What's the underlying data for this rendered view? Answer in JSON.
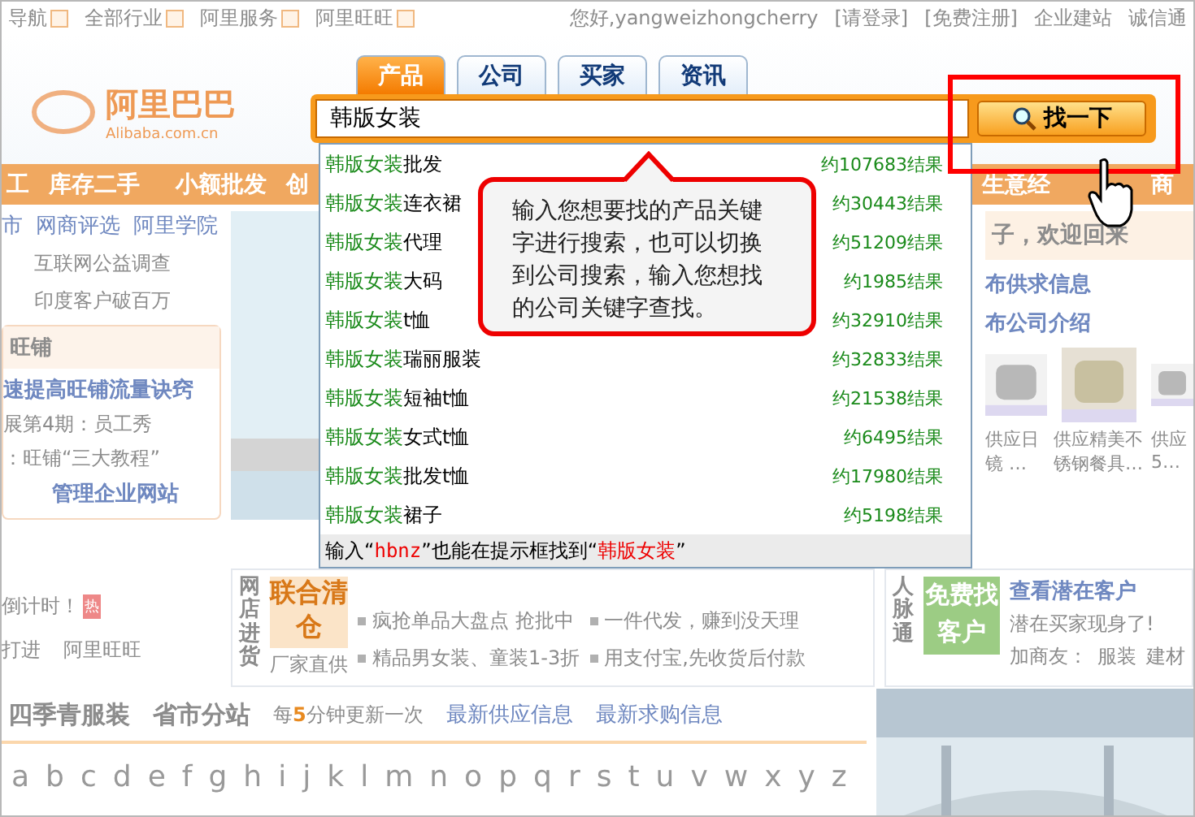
{
  "top_bar": {
    "menus": [
      "导航",
      "全部行业",
      "阿里服务",
      "阿里旺旺"
    ],
    "greeting": "您好,yangweizhongcherry",
    "login": "[请登录]",
    "register": "[免费注册]",
    "right_links": [
      "企业建站",
      "诚信通"
    ]
  },
  "logo": {
    "name": "阿里巴巴",
    "domain": "Alibaba.com.cn"
  },
  "nav": [
    "工",
    "库存二手",
    "小额批发",
    "创",
    "生意经",
    "商"
  ],
  "left": {
    "links": [
      "市",
      "网商评选",
      "阿里学院"
    ],
    "news": [
      "互联网公益调查",
      "印度客户破百万"
    ],
    "shop_title": "旺铺",
    "shop_headline": "速提高旺铺流量诀窍",
    "shop_items": [
      "展第4期：员工秀",
      "：旺铺“三大教程”"
    ],
    "manage": "管理企业网站",
    "countdown": "倒计时！",
    "hot": "热",
    "more": [
      "打进",
      "阿里旺旺"
    ]
  },
  "right": {
    "welcome": "子，欢迎回来",
    "actions": [
      "布供求信息",
      "布公司介绍"
    ],
    "products": [
      "供应日镜 …",
      "供应精美不锈钢餐具…",
      "供应5…"
    ]
  },
  "market": {
    "title": "网店进货",
    "promo": "联合清仓",
    "promo_caption": "厂家直供",
    "items": [
      "疯抢单品大盘点 抢批中",
      "精品男女装、童装1-3折"
    ],
    "items_2": [
      "一件代发，赚到没天理",
      "用支付宝,先收货后付款"
    ]
  },
  "contacts": {
    "title": "人脉通",
    "badge": "免费找客户",
    "link": "查看潜在客户",
    "text": "潜在买家现身了!",
    "tags": [
      "加商友：",
      "服装",
      "建材"
    ]
  },
  "categories": {
    "tabs": [
      "四季青服装",
      "省市分站"
    ],
    "update_before": "每",
    "update_num": "5",
    "update_after": "分钟更新一次",
    "links": [
      "最新供应信息",
      "最新求购信息"
    ]
  },
  "letters": [
    "a",
    "b",
    "c",
    "d",
    "e",
    "f",
    "g",
    "h",
    "i",
    "j",
    "k",
    "l",
    "m",
    "n",
    "o",
    "p",
    "q",
    "r",
    "s",
    "t",
    "u",
    "v",
    "w",
    "x",
    "y",
    "z"
  ],
  "search": {
    "tabs": [
      {
        "label": "产品",
        "selected": true
      },
      {
        "label": "公司",
        "selected": false
      },
      {
        "label": "买家",
        "selected": false
      },
      {
        "label": "资讯",
        "selected": false
      }
    ],
    "value": "韩版女装",
    "button": "找一下",
    "suggestions": [
      {
        "keyword": "韩版女装",
        "rest": "批发",
        "count": "约107683结果"
      },
      {
        "keyword": "韩版女装",
        "rest": "连衣裙",
        "count": "约30443结果"
      },
      {
        "keyword": "韩版女装",
        "rest": "代理",
        "count": "约51209结果"
      },
      {
        "keyword": "韩版女装",
        "rest": "大码",
        "count": "约1985结果"
      },
      {
        "keyword": "韩版女装",
        "rest": "t恤",
        "count": "约32910结果"
      },
      {
        "keyword": "韩版女装",
        "rest": "瑞丽服装",
        "count": "约32833结果"
      },
      {
        "keyword": "韩版女装",
        "rest": "短袖t恤",
        "count": "约21538结果"
      },
      {
        "keyword": "韩版女装",
        "rest": "女式t恤",
        "count": "约6495结果"
      },
      {
        "keyword": "韩版女装",
        "rest": "批发t恤",
        "count": "约17980结果"
      },
      {
        "keyword": "韩版女装",
        "rest": "裙子",
        "count": "约5198结果"
      }
    ],
    "hint": {
      "before": "输入“",
      "code": "hbnz",
      "middle": "”也能在提示框找到“",
      "target": "韩版女装",
      "after": "”"
    }
  },
  "callout": "输入您想要找的产品关键字进行搜索，也可以切换到公司搜索，输入您想找的公司关键字查找。"
}
